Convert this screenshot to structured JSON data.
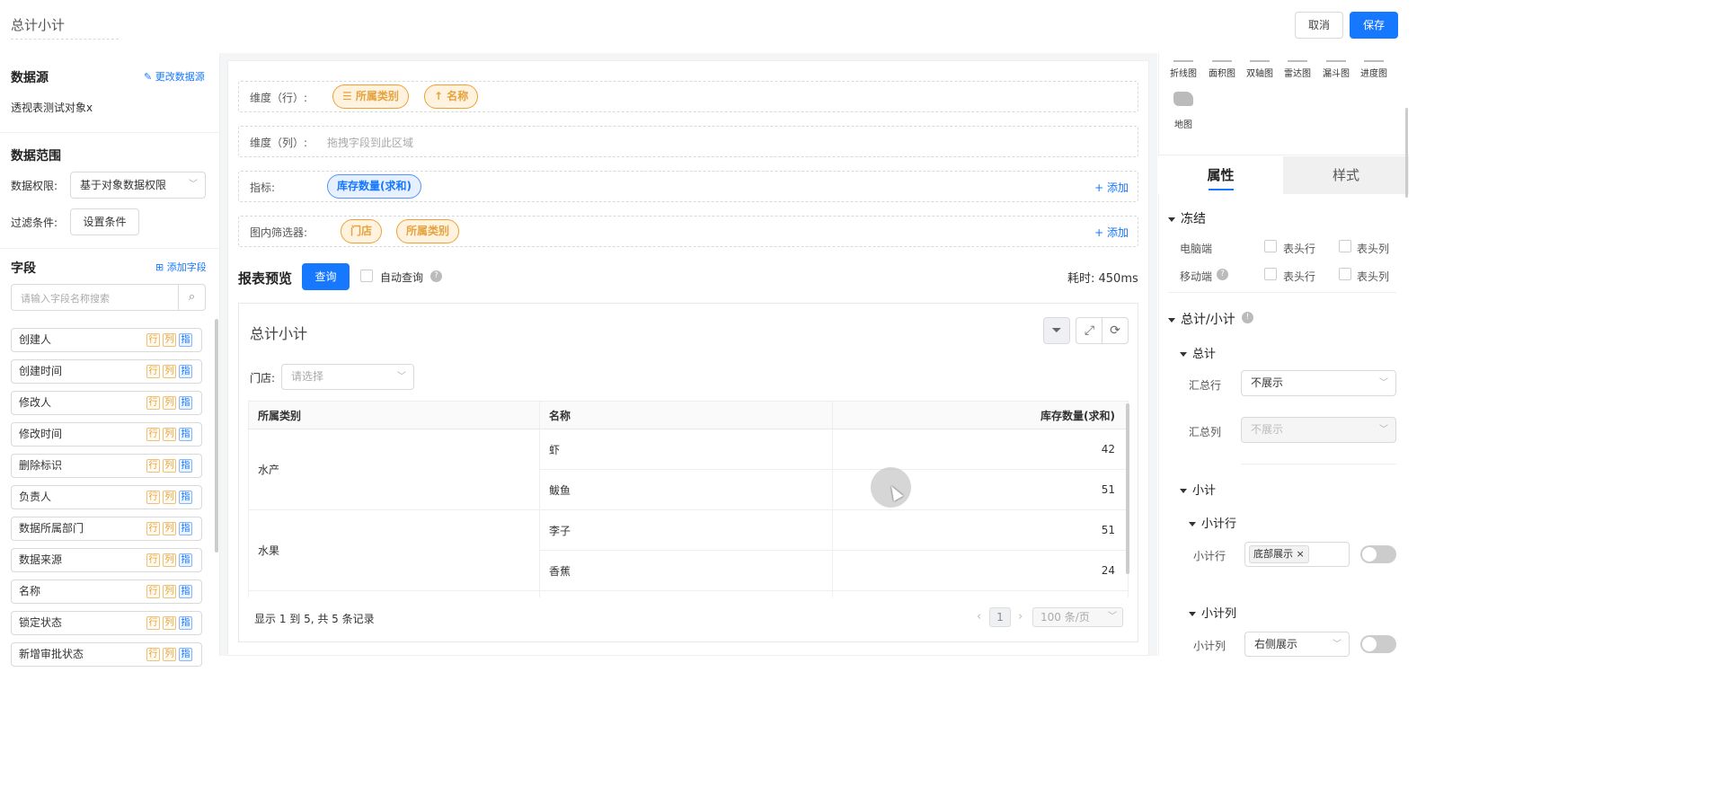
{
  "header": {
    "title": "总计小计",
    "cancel_label": "取消",
    "save_label": "保存"
  },
  "left": {
    "datasource_title": "数据源",
    "change_datasource": "更改数据源",
    "datasource_name": "透视表测试对象x",
    "range_title": "数据范围",
    "permission_label": "数据权限:",
    "permission_value": "基于对象数据权限",
    "filter_label": "过滤条件:",
    "filter_button": "设置条件",
    "fields_title": "字段",
    "add_field": "添加字段",
    "search_placeholder": "请输入字段名称搜索",
    "tag_row": "行",
    "tag_col": "列",
    "tag_ind": "指",
    "fields": [
      "创建人",
      "创建时间",
      "修改人",
      "修改时间",
      "删除标识",
      "负责人",
      "数据所属部门",
      "数据来源",
      "名称",
      "锁定状态",
      "新增审批状态"
    ]
  },
  "center": {
    "dim_row_label": "维度（行）:",
    "dim_row_pills": [
      "☰ 所属类别",
      "↑ 名称"
    ],
    "dim_col_label": "维度（列）:",
    "dim_col_hint": "拖拽字段到此区域",
    "indicator_label": "指标:",
    "indicator_pill": "库存数量(求和)",
    "add_label": "+ 添加",
    "inner_filter_label": "图内筛选器:",
    "inner_filter_pills": [
      "门店",
      "所属类别"
    ],
    "preview_title": "报表预览",
    "query_button": "查询",
    "auto_query": "自动查询",
    "elapsed": "耗时: 450ms",
    "report_title": "总计小计",
    "store_label": "门店:",
    "store_placeholder": "请选择",
    "table": {
      "headers": [
        "所属类别",
        "名称",
        "库存数量(求和)"
      ],
      "groups": [
        {
          "category": "水产",
          "rows": [
            {
              "name": "虾",
              "value": "42"
            },
            {
              "name": "鲅鱼",
              "value": "51"
            }
          ]
        },
        {
          "category": "水果",
          "rows": [
            {
              "name": "李子",
              "value": "51"
            },
            {
              "name": "香蕉",
              "value": "24"
            }
          ]
        }
      ]
    },
    "footer_info": "显示 1 到 5, 共 5 条记录",
    "page_current": "1",
    "page_size": "100 条/页"
  },
  "right": {
    "chart_types": [
      "折线图",
      "面积图",
      "双轴图",
      "雷达图",
      "漏斗图",
      "进度图"
    ],
    "map_label": "地图",
    "tab_props": "属性",
    "tab_style": "样式",
    "freeze_title": "冻结",
    "pc_label": "电脑端",
    "mobile_label": "移动端",
    "header_row": "表头行",
    "header_col": "表头列",
    "total_sub_title": "总计/小计",
    "total_title": "总计",
    "summary_row_label": "汇总行",
    "summary_row_value": "不展示",
    "summary_col_label": "汇总列",
    "summary_col_value": "不展示",
    "subtotal_title": "小计",
    "subtotal_row_title": "小计行",
    "subtotal_row_label": "小计行",
    "subtotal_row_chip": "底部展示",
    "subtotal_col_title": "小计列",
    "subtotal_col_label": "小计列",
    "subtotal_col_value": "右侧展示"
  },
  "colors": {
    "primary": "#1677ff",
    "orange": "#e6a23c"
  }
}
